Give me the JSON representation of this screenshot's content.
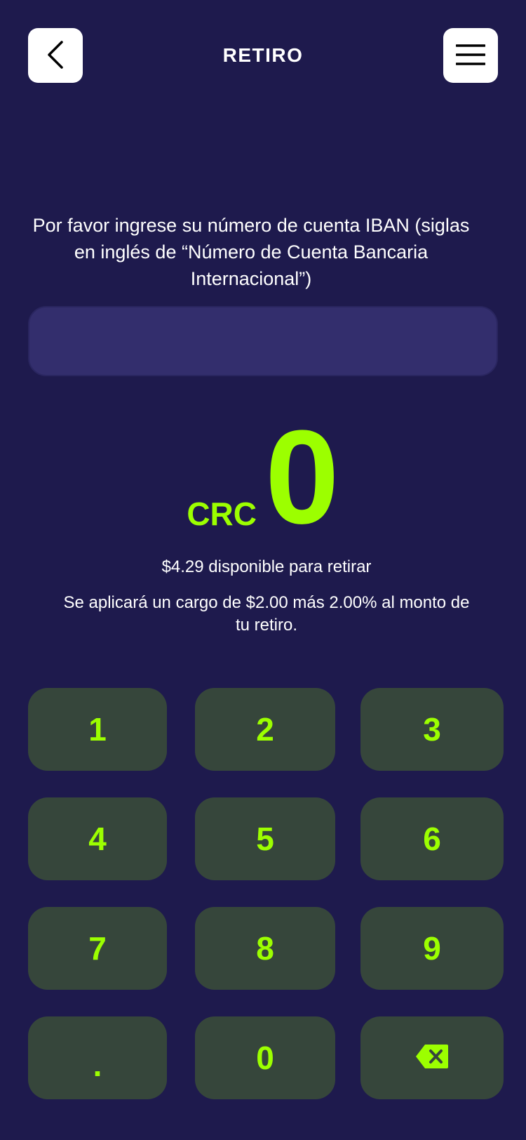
{
  "header": {
    "title": "RETIRO",
    "back_icon": "chevron-left-icon",
    "menu_icon": "hamburger-menu-icon"
  },
  "prompt": {
    "text": "Por favor ingrese su número de cuenta IBAN (siglas en inglés de “Número de Cuenta Bancaria Internacional”)"
  },
  "iban_input": {
    "value": "",
    "placeholder": ""
  },
  "amount": {
    "currency": "CRC",
    "value": "0"
  },
  "available_text": "$4.29 disponible para retirar",
  "fee_text": "Se aplicará un cargo de $2.00 más 2.00% al monto de tu retiro.",
  "keypad": {
    "keys": [
      "1",
      "2",
      "3",
      "4",
      "5",
      "6",
      "7",
      "8",
      "9",
      ".",
      "0"
    ],
    "backspace_icon": "backspace-icon"
  },
  "colors": {
    "background": "#1e1a4d",
    "accent": "#9cff00",
    "key_background": "#36463b",
    "input_background": "#332e6d",
    "header_button": "#ffffff"
  }
}
